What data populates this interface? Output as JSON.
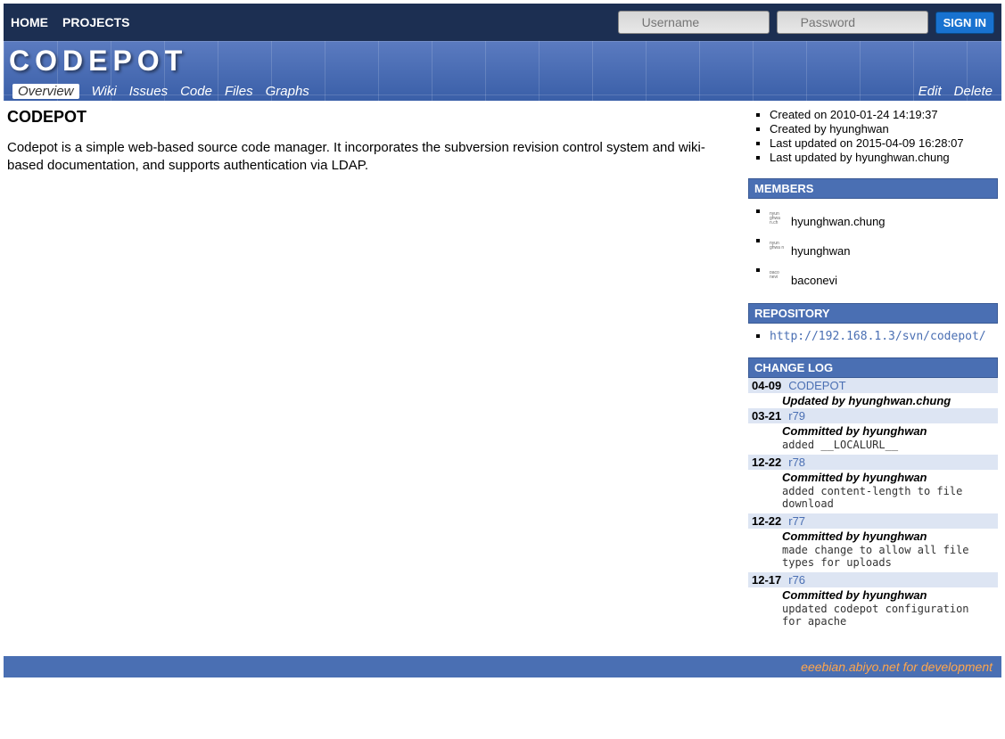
{
  "topnav": {
    "home": "HOME",
    "projects": "PROJECTS"
  },
  "login": {
    "username_placeholder": "Username",
    "password_placeholder": "Password",
    "signin": "SIGN IN"
  },
  "site_title": "CODEPOT",
  "tabs": {
    "overview": "Overview",
    "wiki": "Wiki",
    "issues": "Issues",
    "code": "Code",
    "files": "Files",
    "graphs": "Graphs"
  },
  "actions": {
    "edit": "Edit",
    "delete": "Delete"
  },
  "page_title": "CODEPOT",
  "description": "Codepot is a simple web-based source code manager. It incorporates the subversion revision control system and wiki-based documentation, and supports authentication via LDAP.",
  "meta": [
    "Created on 2010-01-24 14:19:37",
    "Created by hyunghwan",
    "Last updated on 2015-04-09 16:28:07",
    "Last updated by hyunghwan.chung"
  ],
  "members_header": "MEMBERS",
  "members": [
    {
      "avatar": "hyun ghwa n.ch",
      "name": "hyunghwan.chung"
    },
    {
      "avatar": "hyun ghwa n",
      "name": "hyunghwan"
    },
    {
      "avatar": "baco nevi",
      "name": "baconevi"
    }
  ],
  "repository_header": "REPOSITORY",
  "repository_url": "http://192.168.1.3/svn/codepot/",
  "changelog_header": "CHANGE LOG",
  "changelog": [
    {
      "date": "04-09",
      "rev": "CODEPOT",
      "by": "Updated by hyunghwan.chung",
      "msg": ""
    },
    {
      "date": "03-21",
      "rev": "r79",
      "by": "Committed by hyunghwan",
      "msg": "added __LOCALURL__"
    },
    {
      "date": "12-22",
      "rev": "r78",
      "by": "Committed by hyunghwan",
      "msg": "added content-length to file download"
    },
    {
      "date": "12-22",
      "rev": "r77",
      "by": "Committed by hyunghwan",
      "msg": "made change to allow all file types for uploads"
    },
    {
      "date": "12-17",
      "rev": "r76",
      "by": "Committed by hyunghwan",
      "msg": "updated codepot configuration for apache"
    }
  ],
  "footer": "eeebian.abiyo.net for development"
}
